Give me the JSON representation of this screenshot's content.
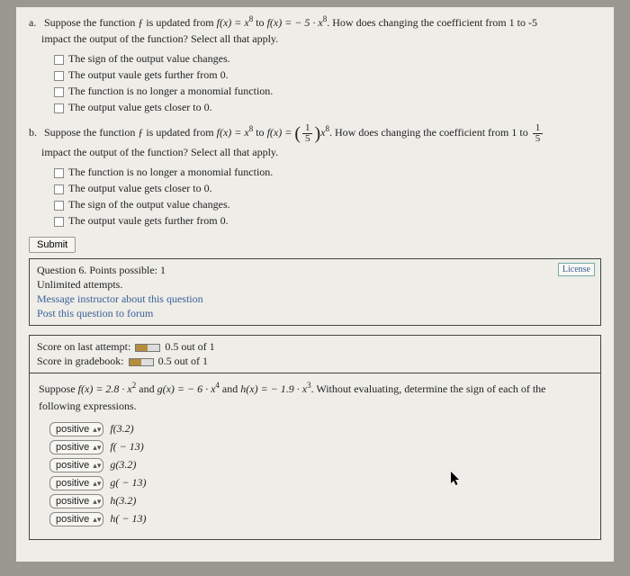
{
  "q5": {
    "a": {
      "label": "a.",
      "prefix": "Suppose the function ƒ is updated from ",
      "f1_lhs": "f(x) = x",
      "f1_exp": "8",
      "mid": " to ",
      "f2_lhs": "f(x) = − 5 · x",
      "f2_exp": "8",
      "suffix1": ". How does changing the coefficient from 1 to -5",
      "suffix2": "impact the output of the function? Select all that apply.",
      "options": [
        "The sign of the output value changes.",
        "The output vaule gets further from 0.",
        "The function is no longer a monomial function.",
        "The output value gets closer to 0."
      ]
    },
    "b": {
      "label": "b.",
      "prefix": "Suppose the function ƒ is updated from ",
      "f1_lhs": "f(x) = x",
      "f1_exp": "8",
      "mid": " to ",
      "f2_lhs": "f(x) = ",
      "frac_num": "1",
      "frac_den": "5",
      "f2_rhs": "x",
      "f2_exp": "8",
      "suffix1": ". How does changing the coefficient from 1 to ",
      "frac2_num": "1",
      "frac2_den": "5",
      "suffix2": "impact the output of the function? Select all that apply.",
      "options": [
        "The function is no longer a monomial function.",
        "The output value gets closer to 0.",
        "The sign of the output value changes.",
        "The output vaule gets further from 0."
      ]
    },
    "submit": "Submit"
  },
  "meta": {
    "line1": "Question 6. Points possible: 1",
    "line2": "Unlimited attempts.",
    "link1": "Message instructor about this question",
    "link2": "Post this question to forum",
    "license": "License"
  },
  "score": {
    "line1_pre": "Score on last attempt: ",
    "line1_post": " 0.5 out of 1",
    "line2_pre": "Score in gradebook: ",
    "line2_post": " 0.5 out of 1"
  },
  "q6": {
    "prompt_pre": "Suppose ",
    "f_lhs": "f(x) = 2.8 · x",
    "f_exp": "2",
    "and1": " and ",
    "g_lhs": "g(x) = − 6 · x",
    "g_exp": "4",
    "and2": " and ",
    "h_lhs": "h(x) = − 1.9 · x",
    "h_exp": "3",
    "prompt_post": ". Without evaluating, determine the sign of each of the",
    "prompt_line2": "following expressions.",
    "select_value": "positive",
    "rows": [
      {
        "fn": "f(3.2)"
      },
      {
        "fn": "f( − 13)"
      },
      {
        "fn": "g(3.2)"
      },
      {
        "fn": "g( − 13)"
      },
      {
        "fn": "h(3.2)"
      },
      {
        "fn": "h( − 13)"
      }
    ]
  }
}
